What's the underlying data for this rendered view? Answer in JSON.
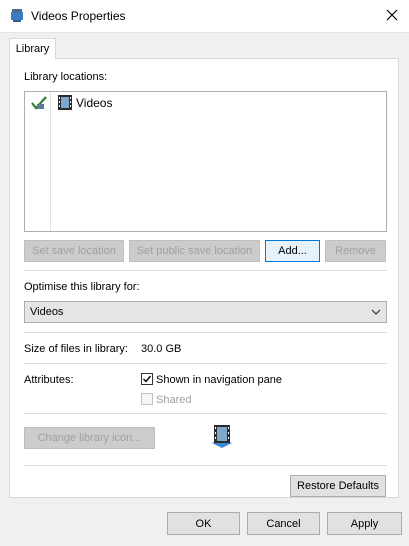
{
  "window": {
    "title": "Videos Properties"
  },
  "tabs": [
    {
      "label": "Library"
    }
  ],
  "library": {
    "locations_label": "Library locations:",
    "locations": [
      {
        "name": "Videos"
      }
    ],
    "buttons": {
      "set_save": "Set save location",
      "set_public_save": "Set public save location",
      "add": "Add...",
      "remove": "Remove"
    },
    "optimise_label": "Optimise this library for:",
    "optimise_value": "Videos",
    "size_label": "Size of files in library:",
    "size_value": "30.0 GB",
    "attributes_label": "Attributes:",
    "shown_in_nav_label": "Shown in navigation pane",
    "shown_in_nav_checked": true,
    "shared_label": "Shared",
    "shared_checked": false,
    "change_icon_label": "Change library icon...",
    "restore_defaults_label": "Restore Defaults"
  },
  "footer": {
    "ok": "OK",
    "cancel": "Cancel",
    "apply": "Apply"
  },
  "icons": {
    "title": "library-icon",
    "close": "close-icon",
    "location_status": "save-location-checkmark-icon",
    "location_item": "video-folder-icon",
    "dropdown": "chevron-down-icon",
    "library_preview": "video-library-icon"
  },
  "colors": {
    "accent_border": "#0078d7",
    "dialog_bg": "#f0f0f0"
  }
}
